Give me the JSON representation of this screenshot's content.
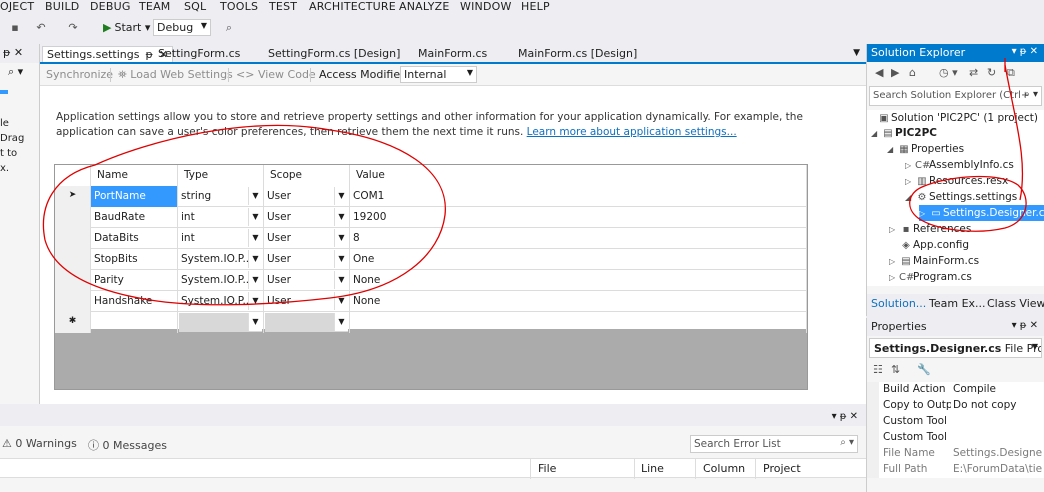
{
  "menu": [
    "OJECT",
    "BUILD",
    "DEBUG",
    "TEAM",
    "SQL",
    "TOOLS",
    "TEST",
    "ARCHITECTURE",
    "ANALYZE",
    "WINDOW",
    "HELP"
  ],
  "toolbar": {
    "start_label": "Start",
    "config_value": "Debug"
  },
  "left_panel": {
    "lines": [
      "le",
      "Drag",
      "t to",
      "x."
    ]
  },
  "doc_tabs": [
    "Settings.settings",
    "SettingForm.cs",
    "SettingForm.cs [Design]",
    "MainForm.cs",
    "MainForm.cs [Design]"
  ],
  "settings_toolbar": {
    "synchronize": "Synchronize",
    "load_web_settings": "Load Web Settings",
    "view_code": "View Code",
    "access_modifier_label": "Access Modifier:",
    "access_modifier_value": "Internal"
  },
  "info": {
    "text": "Application settings allow you to store and retrieve property settings and other information for your application dynamically. For example, the application can save a user's color preferences, then retrieve them the next time it runs.",
    "link": "Learn more about application settings..."
  },
  "grid": {
    "headers": [
      "Name",
      "Type",
      "Scope",
      "Value"
    ],
    "rows": [
      {
        "name": "PortName",
        "type": "string",
        "scope": "User",
        "value": "COM1"
      },
      {
        "name": "BaudRate",
        "type": "int",
        "scope": "User",
        "value": "19200"
      },
      {
        "name": "DataBits",
        "type": "int",
        "scope": "User",
        "value": "8"
      },
      {
        "name": "StopBits",
        "type": "System.IO.P...",
        "scope": "User",
        "value": "One"
      },
      {
        "name": "Parity",
        "type": "System.IO.P...",
        "scope": "User",
        "value": "None"
      },
      {
        "name": "Handshake",
        "type": "System.IO.P...",
        "scope": "User",
        "value": "None"
      }
    ]
  },
  "error_list": {
    "warnings": "0 Warnings",
    "messages": "0 Messages",
    "search_placeholder": "Search Error List",
    "columns": [
      "File",
      "Line",
      "Column",
      "Project"
    ]
  },
  "solution_explorer": {
    "title": "Solution Explorer",
    "search_placeholder": "Search Solution Explorer (Ctrl+",
    "tree": [
      {
        "label": "Solution 'PIC2PC' (1 project)",
        "icon": "solution-icon"
      },
      {
        "label": "PIC2PC",
        "icon": "csharp-project-icon"
      },
      {
        "label": "Properties",
        "icon": "properties-icon"
      },
      {
        "label": "AssemblyInfo.cs",
        "icon": "csharp-file-icon"
      },
      {
        "label": "Resources.resx",
        "icon": "resources-icon"
      },
      {
        "label": "Settings.settings",
        "icon": "settings-gear-icon"
      },
      {
        "label": "Settings.Designer.cs",
        "icon": "designer-file-icon"
      },
      {
        "label": "References",
        "icon": "references-icon"
      },
      {
        "label": "App.config",
        "icon": "config-file-icon"
      },
      {
        "label": "MainForm.cs",
        "icon": "form-file-icon"
      },
      {
        "label": "Program.cs",
        "icon": "csharp-file-icon"
      }
    ],
    "tabs": [
      "Solution...",
      "Team Ex...",
      "Class View"
    ]
  },
  "properties": {
    "title": "Properties",
    "object_name": "Settings.Designer.cs",
    "object_type": "File Propert",
    "rows": [
      {
        "key": "Build Action",
        "value": "Compile"
      },
      {
        "key": "Copy to Output",
        "value": "Do not copy"
      },
      {
        "key": "Custom Tool",
        "value": ""
      },
      {
        "key": "Custom Tool N",
        "value": ""
      },
      {
        "key": "File Name",
        "value": "Settings.Designer.cs"
      },
      {
        "key": "Full Path",
        "value": "E:\\ForumData\\tien"
      }
    ]
  },
  "colors": {
    "accent": "#007acc",
    "selection": "#3399ff",
    "annotation": "#e00000"
  }
}
